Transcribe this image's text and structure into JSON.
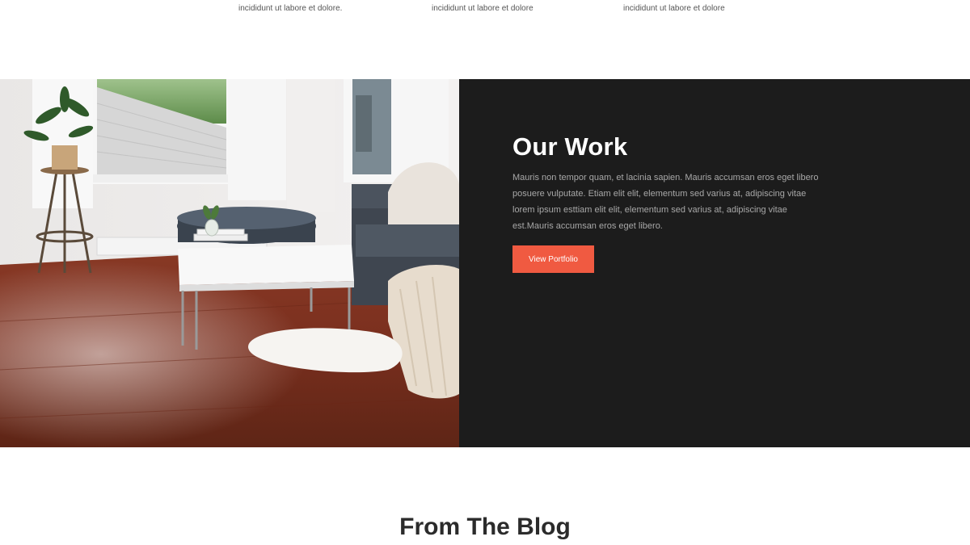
{
  "features": {
    "captions": [
      "incididunt ut labore et dolore.",
      "incididunt ut labore et dolore",
      "incididunt ut labore et dolore"
    ]
  },
  "work": {
    "title": "Our Work",
    "body": "Mauris non tempor quam, et lacinia sapien. Mauris accumsan eros eget libero posuere vulputate. Etiam elit elit, elementum sed varius at, adipiscing vitae lorem ipsum esttiam elit elit, elementum sed varius at, adipiscing vitae est.Mauris accumsan eros eget libero.",
    "button_label": "View Portfolio",
    "accent_color": "#f05a41",
    "panel_color": "#1c1c1c"
  },
  "blog": {
    "title": "From The Blog"
  }
}
